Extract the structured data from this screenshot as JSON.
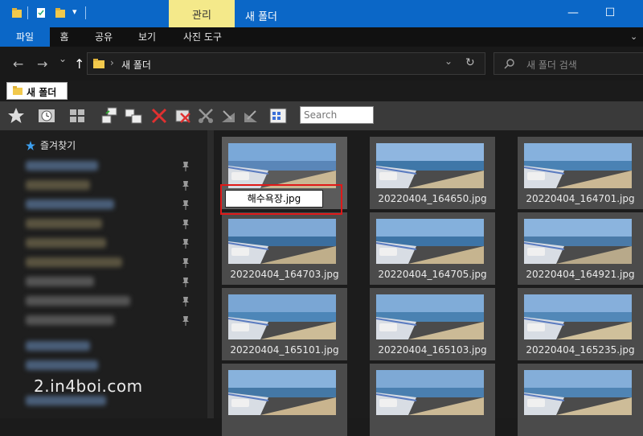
{
  "titlebar": {
    "manage_tab": "관리",
    "window_title": "새 폴더",
    "minimize": "—",
    "maximize": "☐",
    "quick_access_dropdown": "▾"
  },
  "ribbon": {
    "tabs": [
      "파일",
      "홈",
      "공유",
      "보기",
      "사진 도구"
    ]
  },
  "address": {
    "back": "←",
    "forward": "→",
    "recent": "⌄",
    "up": "↑",
    "separator": "›",
    "path": "새 폴더",
    "dropdown": "⌄",
    "refresh": "↻",
    "search_placeholder": "새 폴더 검색"
  },
  "folder_tab": {
    "label": "새 폴더"
  },
  "toolbar": {
    "search_placeholder": "Search"
  },
  "nav": {
    "favorites": "즐겨찾기"
  },
  "watermark": "2.in4boi.com",
  "files": [
    "해수욕장.jpg",
    "20220404_164650.jpg",
    "20220404_164701.jpg",
    "20220404_164703.jpg",
    "20220404_164705.jpg",
    "20220404_164921.jpg",
    "20220404_165101.jpg",
    "20220404_165103.jpg",
    "20220404_165235.jpg",
    "",
    "",
    ""
  ],
  "rename_value": "해수욕장.jpg",
  "colors": {
    "accent": "#0b67c7",
    "manage_tab": "#f4e98a",
    "highlight_box": "#e01818"
  }
}
